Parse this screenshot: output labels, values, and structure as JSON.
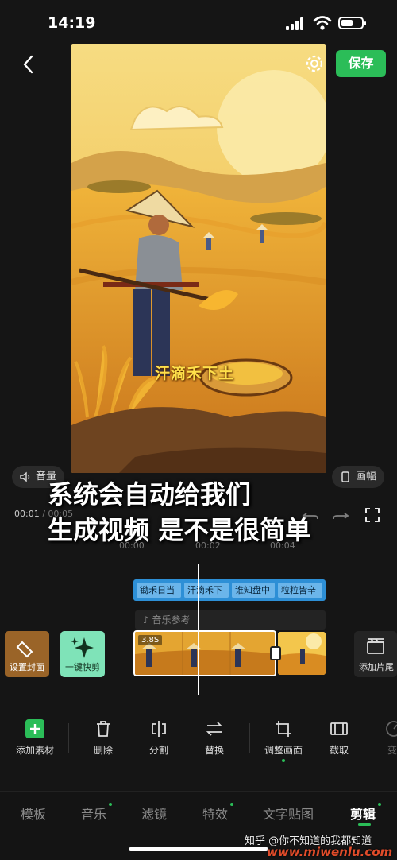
{
  "status_bar": {
    "time": "14:19"
  },
  "top_bar": {
    "save_label": "保存"
  },
  "preview": {
    "caption": "汗滴禾下土"
  },
  "controls": {
    "volume_label": "音量",
    "frame_label": "画幅",
    "current_time": "00:01",
    "total_time": "00:05",
    "time_separator": " / "
  },
  "overlay_text": {
    "line1": "系统会自动给我们",
    "line2": "生成视频 是不是很简单"
  },
  "ruler": [
    "00:00",
    "00:02",
    "00:04"
  ],
  "timeline": {
    "text_chips": [
      "锄禾日当",
      "汗滴禾下",
      "谁知盘中",
      "粒粒皆辛"
    ],
    "music_label": "音乐参考",
    "clip_duration": "3.8S",
    "cover_label": "设置封面",
    "quick_label": "一键快剪",
    "tail_label": "添加片尾"
  },
  "toolbar": [
    {
      "label": "添加素材",
      "icon": "plus-icon"
    },
    {
      "label": "删除",
      "icon": "trash-icon"
    },
    {
      "label": "分割",
      "icon": "split-icon"
    },
    {
      "label": "替换",
      "icon": "replace-icon"
    },
    {
      "label": "调整画面",
      "icon": "crop-icon"
    },
    {
      "label": "截取",
      "icon": "trim-icon"
    },
    {
      "label": "变",
      "icon": "speed-icon"
    }
  ],
  "tabs": [
    {
      "label": "模板"
    },
    {
      "label": "音乐"
    },
    {
      "label": "滤镜"
    },
    {
      "label": "特效"
    },
    {
      "label": "文字贴图"
    },
    {
      "label": "剪辑"
    }
  ],
  "watermark": {
    "text": "知乎 @你不知道的我都知道",
    "site": "www.miwenlu.com"
  },
  "colors": {
    "accent": "#2bbd58",
    "text_track": "#2d8fd6",
    "background": "#151515"
  }
}
